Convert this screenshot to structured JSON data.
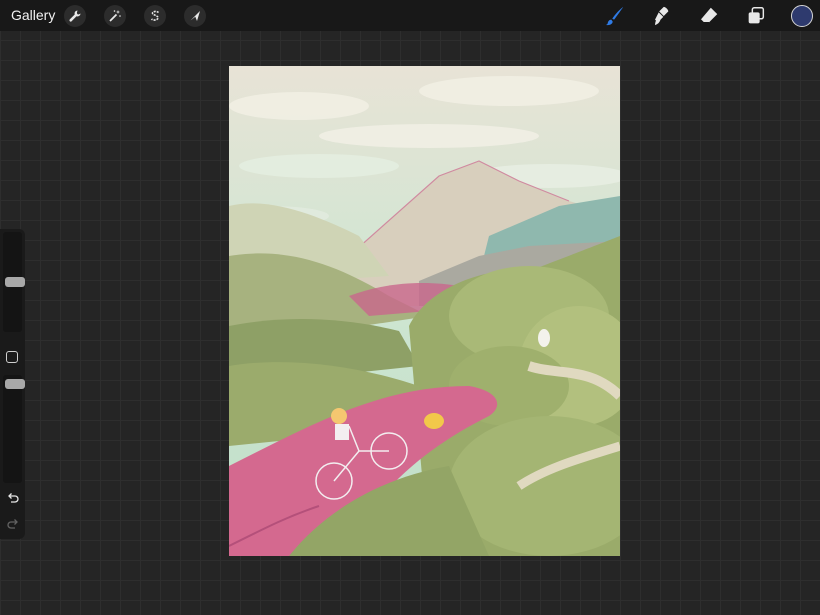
{
  "topbar": {
    "gallery_label": "Gallery",
    "actions_icon": "wrench-icon",
    "adjustments_icon": "magic-wand-icon",
    "selection_icon": "selection-s-icon",
    "transform_icon": "arrow-cursor-icon",
    "brush_icon": "brush-icon",
    "smudge_icon": "smudge-icon",
    "eraser_icon": "eraser-icon",
    "layers_icon": "layers-icon",
    "active_color": "#2e3a6e",
    "brush_active_color": "#2f7be5"
  },
  "sidebar": {
    "brush_size_level": 0.5,
    "opacity_level": 0.04,
    "undo_icon": "undo-icon",
    "redo_icon": "redo-icon"
  },
  "canvas": {
    "artwork": "landscape-illustration"
  }
}
